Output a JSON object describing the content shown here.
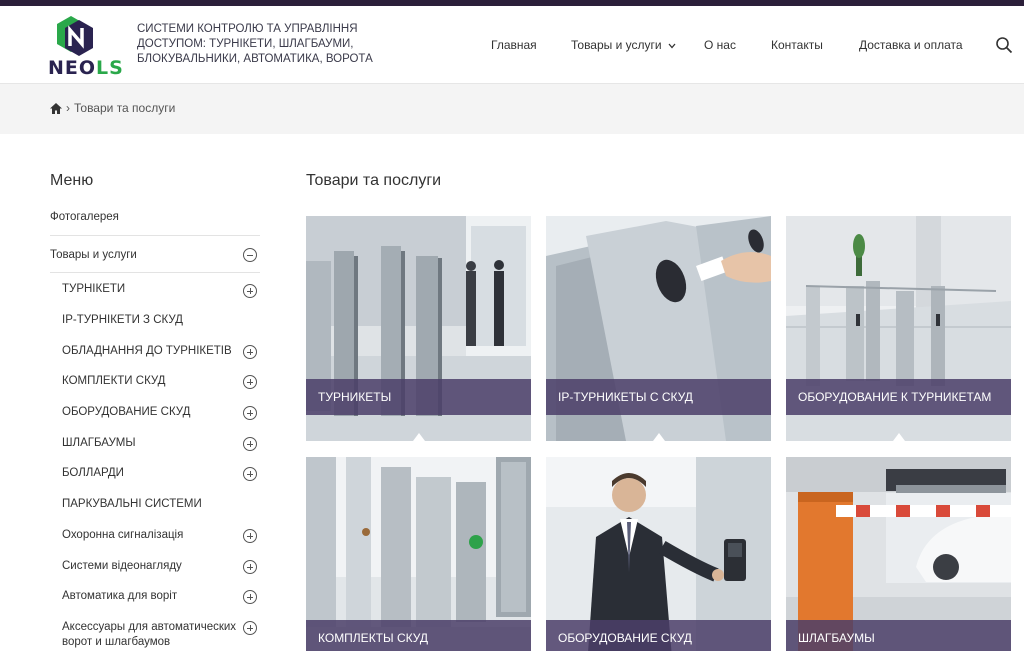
{
  "header": {
    "logo_text_a": "NEO",
    "logo_text_b": "LS",
    "tagline": "СИСТЕМИ КОНТРОЛЮ ТА УПРАВЛІННЯ ДОСТУПОМ: ТУРНІКЕТИ, ШЛАГБАУМИ, БЛОКУВАЛЬНИКИ, АВТОМАТИКА, ВОРОТА",
    "nav": [
      "Главная",
      "Товары и услуги",
      "О нас",
      "Контакты",
      "Доставка и оплата"
    ],
    "icons": {
      "search": "search-icon",
      "dropdown": "chevron-down-icon"
    }
  },
  "breadcrumb": {
    "home_icon": "home-icon",
    "current": "Товари та послуги"
  },
  "sidebar": {
    "title": "Меню",
    "top_items": [
      "Фотогалерея",
      "Товары и услуги"
    ],
    "sub_items": [
      "ТУРНІКЕТИ",
      "IP-ТУРНІКЕТИ З СКУД",
      "ОБЛАДНАННЯ ДО ТУРНІКЕТІВ",
      "КОМПЛЕКТИ СКУД",
      "ОБОРУДОВАНИЕ СКУД",
      "ШЛАГБАУМЫ",
      "БОЛЛАРДИ",
      "ПАРКУВАЛЬНІ СИСТЕМИ",
      "Охоронна сигналізація",
      "Системи відеонагляду",
      "Автоматика для воріт",
      "Аксессуары для автоматических ворот и шлагбаумов"
    ]
  },
  "main": {
    "title": "Товари та послуги",
    "tiles": [
      "ТУРНИКЕТЫ",
      "IP-ТУРНИКЕТЫ С СКУД",
      "ОБОРУДОВАНИЕ К ТУРНИКЕТАМ",
      "КОМПЛЕКТЫ СКУД",
      "ОБОРУДОВАНИЕ СКУД",
      "ШЛАГБАУМЫ"
    ]
  },
  "colors": {
    "accent": "#4b3e69",
    "topbar": "#2b1f3a",
    "logo_green": "#2aa84a",
    "logo_navy": "#2a2350"
  }
}
